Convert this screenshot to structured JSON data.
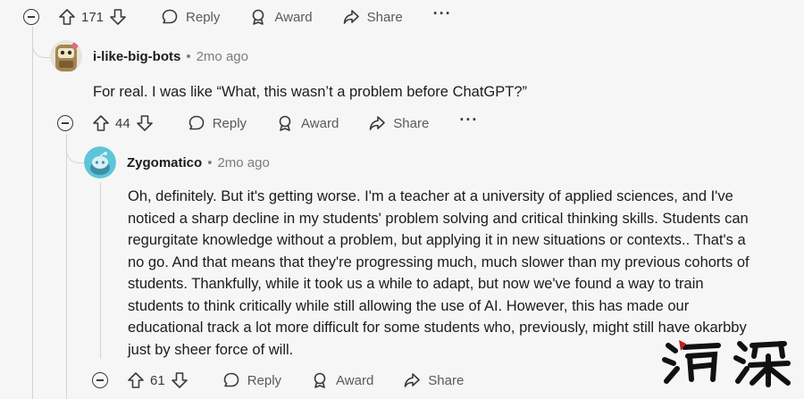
{
  "top_actions": {
    "votes": "171",
    "reply": "Reply",
    "award": "Award",
    "share": "Share",
    "more": "···"
  },
  "comment1": {
    "username": "i-like-big-bots",
    "separator": "•",
    "time": "2mo ago",
    "text": "For real. I was like “What, this wasn’t a problem before ChatGPT?”",
    "actions": {
      "votes": "44",
      "reply": "Reply",
      "award": "Award",
      "share": "Share",
      "more": "···"
    }
  },
  "comment2": {
    "username": "Zygomatico",
    "separator": "•",
    "time": "2mo ago",
    "lines": [
      "Oh, definitely. But it's getting worse. I'm a teacher at a university of applied sciences, and I've",
      "noticed a sharp decline in my students' problem solving and critical thinking skills. Students can",
      "regurgitate knowledge without a problem, but applying it in new situations or contexts.. That's a",
      "no go. And that means that they're progressing much, much slower than my previous cohorts of",
      "students. Thankfully, while it took us a while to adapt, but now we've found a way to train",
      "students to think critically while still allowing the use of AI. However, this has made our",
      "educational track a lot more difficult for some students who, previously, might still have okarbby",
      "just by sheer force of will."
    ],
    "actions": {
      "votes": "61",
      "reply": "Reply",
      "award": "Award",
      "share": "Share"
    }
  },
  "watermark": {
    "text": "清深",
    "ink_color": "#111111",
    "accent_color": "#c81e1e"
  }
}
